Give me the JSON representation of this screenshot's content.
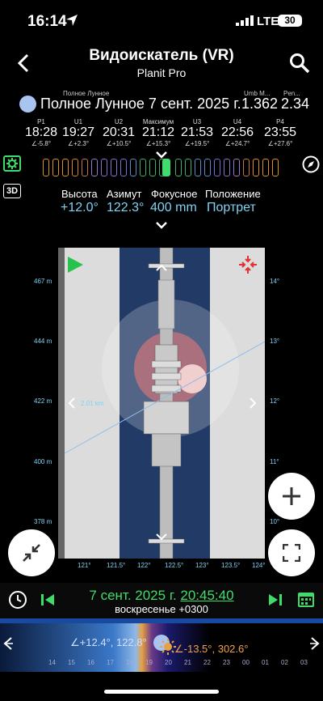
{
  "status": {
    "time": "16:14",
    "network": "LTE",
    "battery": "30"
  },
  "header": {
    "title": "Видоискатель (VR)",
    "subtitle": "Planit Pro"
  },
  "phase": {
    "small_label": "Полное Лунное",
    "title": "Полное Лунное 7 сент. 2025 г.",
    "umb_label": "Umb M...",
    "umb_value": "1.362",
    "pen_label": "Pen...",
    "pen_value": "2.34"
  },
  "timeline": [
    {
      "label": "P1",
      "time": "18:28",
      "angle": "∠-5.8°"
    },
    {
      "label": "U1",
      "time": "19:27",
      "angle": "∠+2.3°"
    },
    {
      "label": "U2",
      "time": "20:31",
      "angle": "∠+10.5°"
    },
    {
      "label": "Максимум",
      "time": "21:12",
      "angle": "∠+15.3°"
    },
    {
      "label": "U3",
      "time": "21:53",
      "angle": "∠+19.5°"
    },
    {
      "label": "U4",
      "time": "22:56",
      "angle": "∠+24.7°"
    },
    {
      "label": "P4",
      "time": "23:55",
      "angle": "∠+27.6°"
    }
  ],
  "params": {
    "height_label": "Высота",
    "height_value": "+12.0°",
    "azimuth_label": "Азимут",
    "azimuth_value": "122.3°",
    "focal_label": "Фокусное",
    "focal_value": "400 mm",
    "orientation_label": "Положение",
    "orientation_value": "Портрет"
  },
  "toggle_3d": "3D",
  "viewer": {
    "left_scale": [
      "467 m",
      "444 m",
      "422 m",
      "400 m",
      "378 m"
    ],
    "right_scale": [
      "14°",
      "13°",
      "12°",
      "11°",
      "10°"
    ],
    "bottom_scale": [
      "121°",
      "121.5°",
      "122°",
      "122.5°",
      "123°",
      "123.5°",
      "124°"
    ],
    "dist_label": "2.01 km"
  },
  "datebar": {
    "date": "7 сент. 2025 г. ",
    "time": "20:45:40",
    "day": "воскресенье +0300"
  },
  "slider": {
    "moon_readout": "∠+12.4°, 122.8°",
    "sun_readout": "∠-13.5°, 302.6°",
    "hours": [
      "14",
      "15",
      "16",
      "17",
      "18",
      "19",
      "20",
      "21",
      "22",
      "23",
      "00",
      "01",
      "02",
      "03"
    ]
  },
  "colors": {
    "accent_green": "#3fdc6b",
    "scale_blue": "#7fd3f5",
    "moon_blue": "#a9c4ef"
  }
}
